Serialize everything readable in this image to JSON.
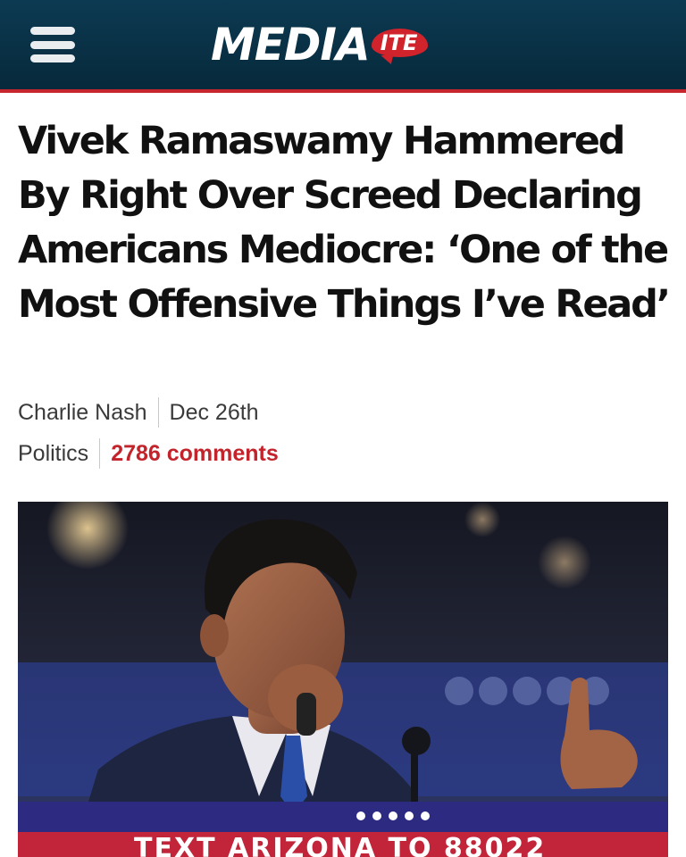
{
  "header": {
    "logo_main": "MEDIA",
    "logo_badge": "ITE",
    "menu_icon": "hamburger-menu-icon",
    "accent_color": "#c8262e",
    "background_color": "#0a3349"
  },
  "article": {
    "headline": "Vivek Ramaswamy Hammered By Right Over Screed Declaring Americans Mediocre: ‘One of the Most Offensive Things I’ve Read’",
    "author": "Charlie Nash",
    "date": "Dec 26th",
    "category": "Politics",
    "comments": "2786 comments",
    "comments_color": "#c3232b"
  },
  "photo": {
    "banner_text": "TEXT ARIZONA TO 88022"
  }
}
